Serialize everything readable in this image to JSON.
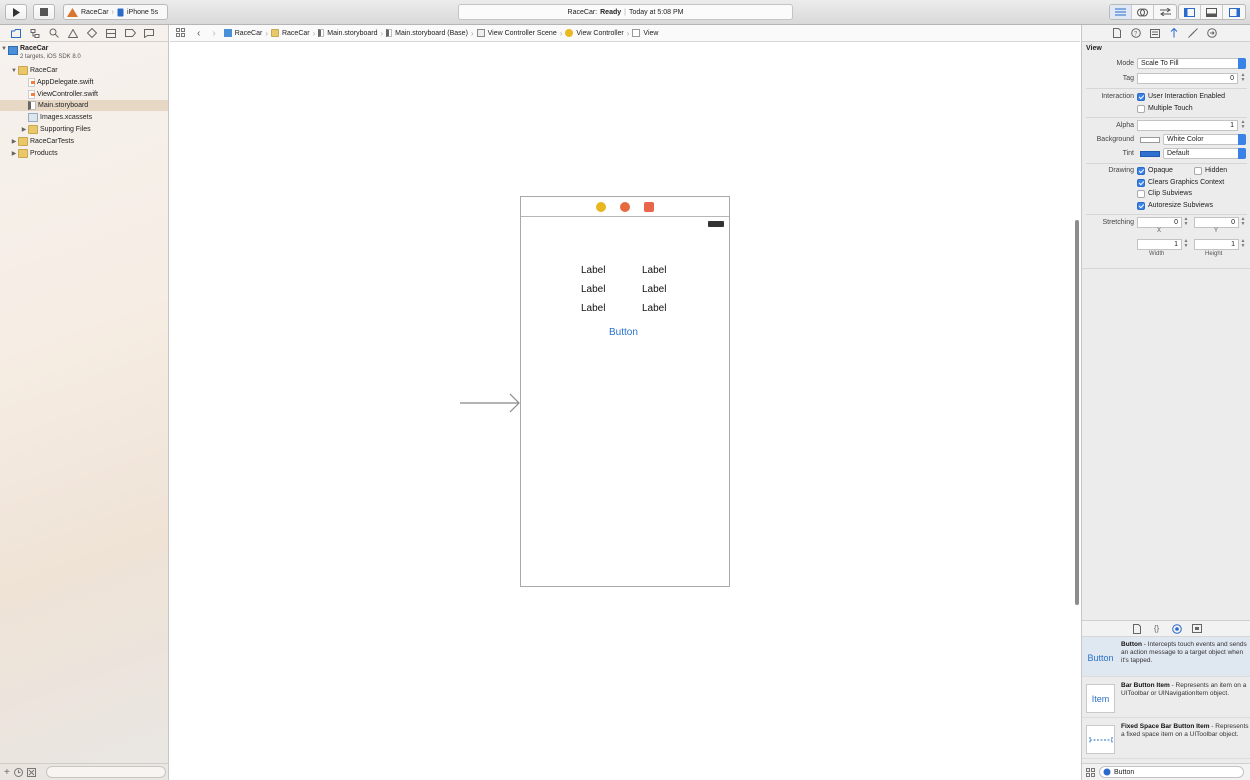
{
  "toolbar": {
    "scheme_target": "RaceCar",
    "scheme_device": "iPhone 5s",
    "status_app": "RaceCar:",
    "status_state": "Ready",
    "status_sep": "|",
    "status_time": "Today at 5:08 PM"
  },
  "navigator": {
    "project_name": "RaceCar",
    "project_sub": "2 targets, iOS SDK 8.0",
    "items": [
      {
        "label": "RaceCar"
      },
      {
        "label": "AppDelegate.swift"
      },
      {
        "label": "ViewController.swift"
      },
      {
        "label": "Main.storyboard"
      },
      {
        "label": "Images.xcassets"
      },
      {
        "label": "Supporting Files"
      },
      {
        "label": "RaceCarTests"
      },
      {
        "label": "Products"
      }
    ]
  },
  "jumpbar": {
    "crumbs": [
      "RaceCar",
      "RaceCar",
      "Main.storyboard",
      "Main.storyboard (Base)",
      "View Controller Scene",
      "View Controller",
      "View"
    ]
  },
  "canvas": {
    "labels": [
      "Label",
      "Label",
      "Label",
      "Label",
      "Label",
      "Label"
    ],
    "button_label": "Button"
  },
  "inspector": {
    "section_title": "View",
    "mode_label": "Mode",
    "mode_value": "Scale To Fill",
    "tag_label": "Tag",
    "tag_value": "0",
    "interaction_label": "Interaction",
    "user_interaction": "User Interaction Enabled",
    "multiple_touch": "Multiple Touch",
    "alpha_label": "Alpha",
    "alpha_value": "1",
    "background_label": "Background",
    "background_value": "White Color",
    "tint_label": "Tint",
    "tint_value": "Default",
    "tint_color": "#2f6fd1",
    "drawing_label": "Drawing",
    "opaque": "Opaque",
    "hidden": "Hidden",
    "clears_graphics": "Clears Graphics Context",
    "clip_subviews": "Clip Subviews",
    "autoresize_subviews": "Autoresize Subviews",
    "stretching_label": "Stretching",
    "stretch_x": "0",
    "stretch_y": "0",
    "stretch_width": "1",
    "stretch_height": "1",
    "x_caption": "X",
    "y_caption": "Y",
    "width_caption": "Width",
    "height_caption": "Height"
  },
  "library": {
    "items": [
      {
        "icon_text": "Button",
        "title": "Button",
        "desc": " - Intercepts touch events and sends an action message to a target object when it's tapped."
      },
      {
        "icon_text": "Item",
        "title": "Bar Button Item",
        "desc": " - Represents an item on a UIToolbar or UINavigationItem object."
      },
      {
        "icon_text": "",
        "title": "Fixed Space Bar Button Item",
        "desc": " - Represents a fixed space item on a UIToolbar object."
      }
    ],
    "filter_value": "Button"
  }
}
